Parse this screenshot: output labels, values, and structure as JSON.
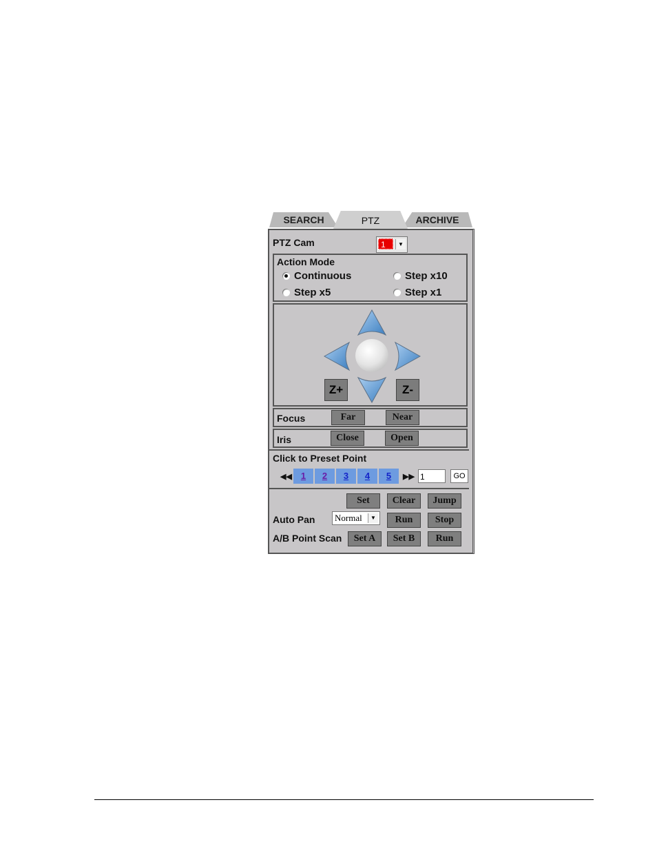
{
  "tabs": [
    {
      "label": "SEARCH",
      "active": false
    },
    {
      "label": "PTZ",
      "active": true
    },
    {
      "label": "ARCHIVE",
      "active": false
    }
  ],
  "ptz_cam": {
    "label": "PTZ Cam",
    "value": "1",
    "color": "#e80000"
  },
  "action_mode": {
    "title": "Action Mode",
    "options": [
      {
        "label": "Continuous",
        "selected": true
      },
      {
        "label": "Step x10",
        "selected": false
      },
      {
        "label": "Step x5",
        "selected": false
      },
      {
        "label": "Step x1",
        "selected": false
      }
    ]
  },
  "direction_pad": {
    "icons": [
      "up-arrow-icon",
      "down-arrow-icon",
      "left-arrow-icon",
      "right-arrow-icon",
      "home-ball-icon"
    ],
    "zoom_in_label": "Z+",
    "zoom_out_label": "Z-",
    "arrow_color": "#5b9bd5"
  },
  "focus": {
    "label": "Focus",
    "far": "Far",
    "near": "Near"
  },
  "iris": {
    "label": "Iris",
    "close": "Close",
    "open": "Open"
  },
  "preset": {
    "title": "Click to Preset Point",
    "prev_icon": "◀◀",
    "next_icon": "▶▶",
    "points": [
      "1",
      "2",
      "3",
      "4",
      "5"
    ],
    "input_value": "1",
    "go_label": "GO"
  },
  "bottom": {
    "set": "Set",
    "clear": "Clear",
    "jump": "Jump",
    "auto_pan_label": "Auto Pan",
    "auto_pan_value": "Normal",
    "run": "Run",
    "stop": "Stop",
    "ab_label": "A/B Point Scan",
    "set_a": "Set A",
    "set_b": "Set B",
    "ab_run": "Run"
  }
}
